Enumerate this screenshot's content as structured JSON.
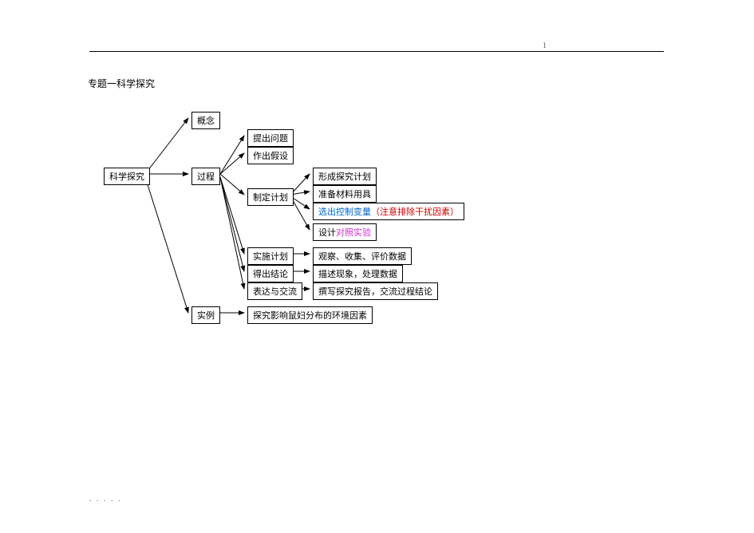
{
  "page_number": "1",
  "title": "专题一科学探究",
  "root": "科学探究",
  "branches": {
    "concept": "概念",
    "process": "过程",
    "example": "实例"
  },
  "process_steps": {
    "ask": "提出问题",
    "hypothesis": "作出假设",
    "plan": "制定计划",
    "implement": "实施计划",
    "conclude": "得出结论",
    "communicate": "表达与交流"
  },
  "plan_details": {
    "formulate": "形成探究计划",
    "materials": "准备材料用具",
    "variable_a": "选出控制变量",
    "variable_b": "（注意排除干扰因素）",
    "design_a": "设计",
    "design_b": "对照实验"
  },
  "implement_detail": "观察、收集、评价数据",
  "conclude_detail": "描述现象，处理数据",
  "communicate_detail": "撰写探究报告，交流过程结论",
  "example_detail": "探究影响鼠妇分布的环境因素",
  "footer": ". .    . .  ."
}
